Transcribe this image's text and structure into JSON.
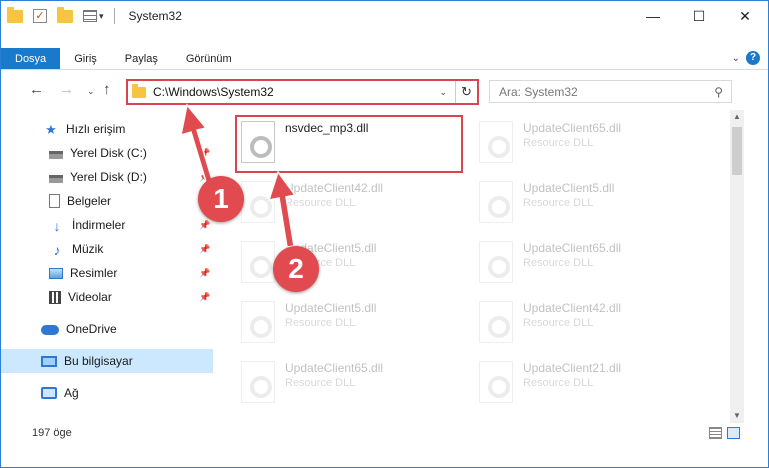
{
  "window": {
    "title": "System32",
    "caption": {
      "minimize": "—",
      "maximize": "☐",
      "close": "✕"
    }
  },
  "quick_access": {
    "dropdown": "▾"
  },
  "ribbon": {
    "tabs": [
      "Dosya",
      "Giriş",
      "Paylaş",
      "Görünüm"
    ],
    "collapse": "⌄",
    "help": "?"
  },
  "nav": {
    "back": "←",
    "forward": "→",
    "recent": "⌄",
    "up": "↑",
    "address": "C:\\Windows\\System32",
    "address_dropdown": "⌄",
    "refresh": "↻",
    "search_placeholder": "Ara: System32",
    "search_icon": "⚲"
  },
  "sidebar": {
    "items": [
      {
        "label": "Hızlı erişim",
        "icon": "star-icon",
        "pinned": false,
        "selected": false
      },
      {
        "label": "Yerel Disk (C:)",
        "icon": "drive-icon",
        "pinned": true,
        "selected": false
      },
      {
        "label": "Yerel Disk (D:)",
        "icon": "drive-icon",
        "pinned": true,
        "selected": false
      },
      {
        "label": "Belgeler",
        "icon": "documents-icon",
        "pinned": true,
        "selected": false
      },
      {
        "label": "İndirmeler",
        "icon": "downloads-icon",
        "pinned": true,
        "selected": false
      },
      {
        "label": "Müzik",
        "icon": "music-icon",
        "pinned": true,
        "selected": false
      },
      {
        "label": "Resimler",
        "icon": "pictures-icon",
        "pinned": true,
        "selected": false
      },
      {
        "label": "Videolar",
        "icon": "videos-icon",
        "pinned": true,
        "selected": false
      },
      {
        "label": "OneDrive",
        "icon": "onedrive-icon",
        "pinned": false,
        "selected": false
      },
      {
        "label": "Bu bilgisayar",
        "icon": "this-pc-icon",
        "pinned": false,
        "selected": true
      },
      {
        "label": "Ağ",
        "icon": "network-icon",
        "pinned": false,
        "selected": false
      }
    ],
    "pin_glyph": "📌"
  },
  "files": [
    {
      "name": "nsvdec_mp3.dll",
      "type": "",
      "highlighted": true
    },
    {
      "name": "UpdateClient65.dll",
      "type": "Resource DLL",
      "highlighted": false
    },
    {
      "name": "UpdateClient42.dll",
      "type": "Resource DLL",
      "highlighted": false
    },
    {
      "name": "UpdateClient5.dll",
      "type": "Resource DLL",
      "highlighted": false
    },
    {
      "name": "UpdateClient5.dll",
      "type": "Resource DLL",
      "highlighted": false
    },
    {
      "name": "UpdateClient65.dll",
      "type": "Resource DLL",
      "highlighted": false
    },
    {
      "name": "UpdateClient5.dll",
      "type": "Resource DLL",
      "highlighted": false
    },
    {
      "name": "UpdateClient42.dll",
      "type": "Resource DLL",
      "highlighted": false
    },
    {
      "name": "UpdateClient65.dll",
      "type": "Resource DLL",
      "highlighted": false
    },
    {
      "name": "UpdateClient21.dll",
      "type": "Resource DLL",
      "highlighted": false
    }
  ],
  "annotations": {
    "step1": "1",
    "step2": "2",
    "color": "#e14a4f"
  },
  "scrollbar": {
    "up": "▲",
    "down": "▼"
  },
  "status": {
    "item_count": "197 öge"
  },
  "colors": {
    "accent": "#1979ca",
    "highlight_border": "#d9454f",
    "selected_bg": "#cce8ff"
  }
}
